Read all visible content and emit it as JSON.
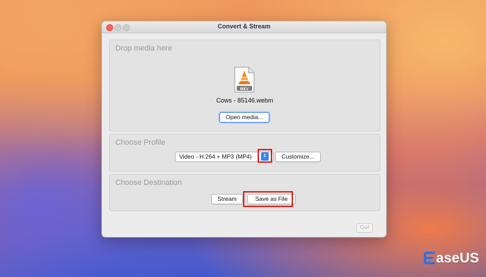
{
  "window": {
    "title": "Convert & Stream"
  },
  "drop_section": {
    "title": "Drop media here",
    "file_badge": "MKV",
    "file_name": "Cows - 85146.webm",
    "open_button": "Open media..."
  },
  "profile_section": {
    "title": "Choose Profile",
    "selected_profile": "Video - H.264 + MP3 (MP4)",
    "customize_button": "Customize..."
  },
  "destination_section": {
    "title": "Choose Destination",
    "stream_button": "Stream",
    "save_button": "Save as File"
  },
  "footer": {
    "go_button": "Go!"
  },
  "watermark": {
    "brand_text": "aseUS"
  },
  "colors": {
    "accent": "#3a83f0",
    "highlight": "#e0201c",
    "close": "#fe5f57"
  },
  "icons": [
    "close-icon",
    "minimize-icon",
    "maximize-icon",
    "file-icon",
    "chevron-updown-icon",
    "easeus-logo-icon"
  ]
}
